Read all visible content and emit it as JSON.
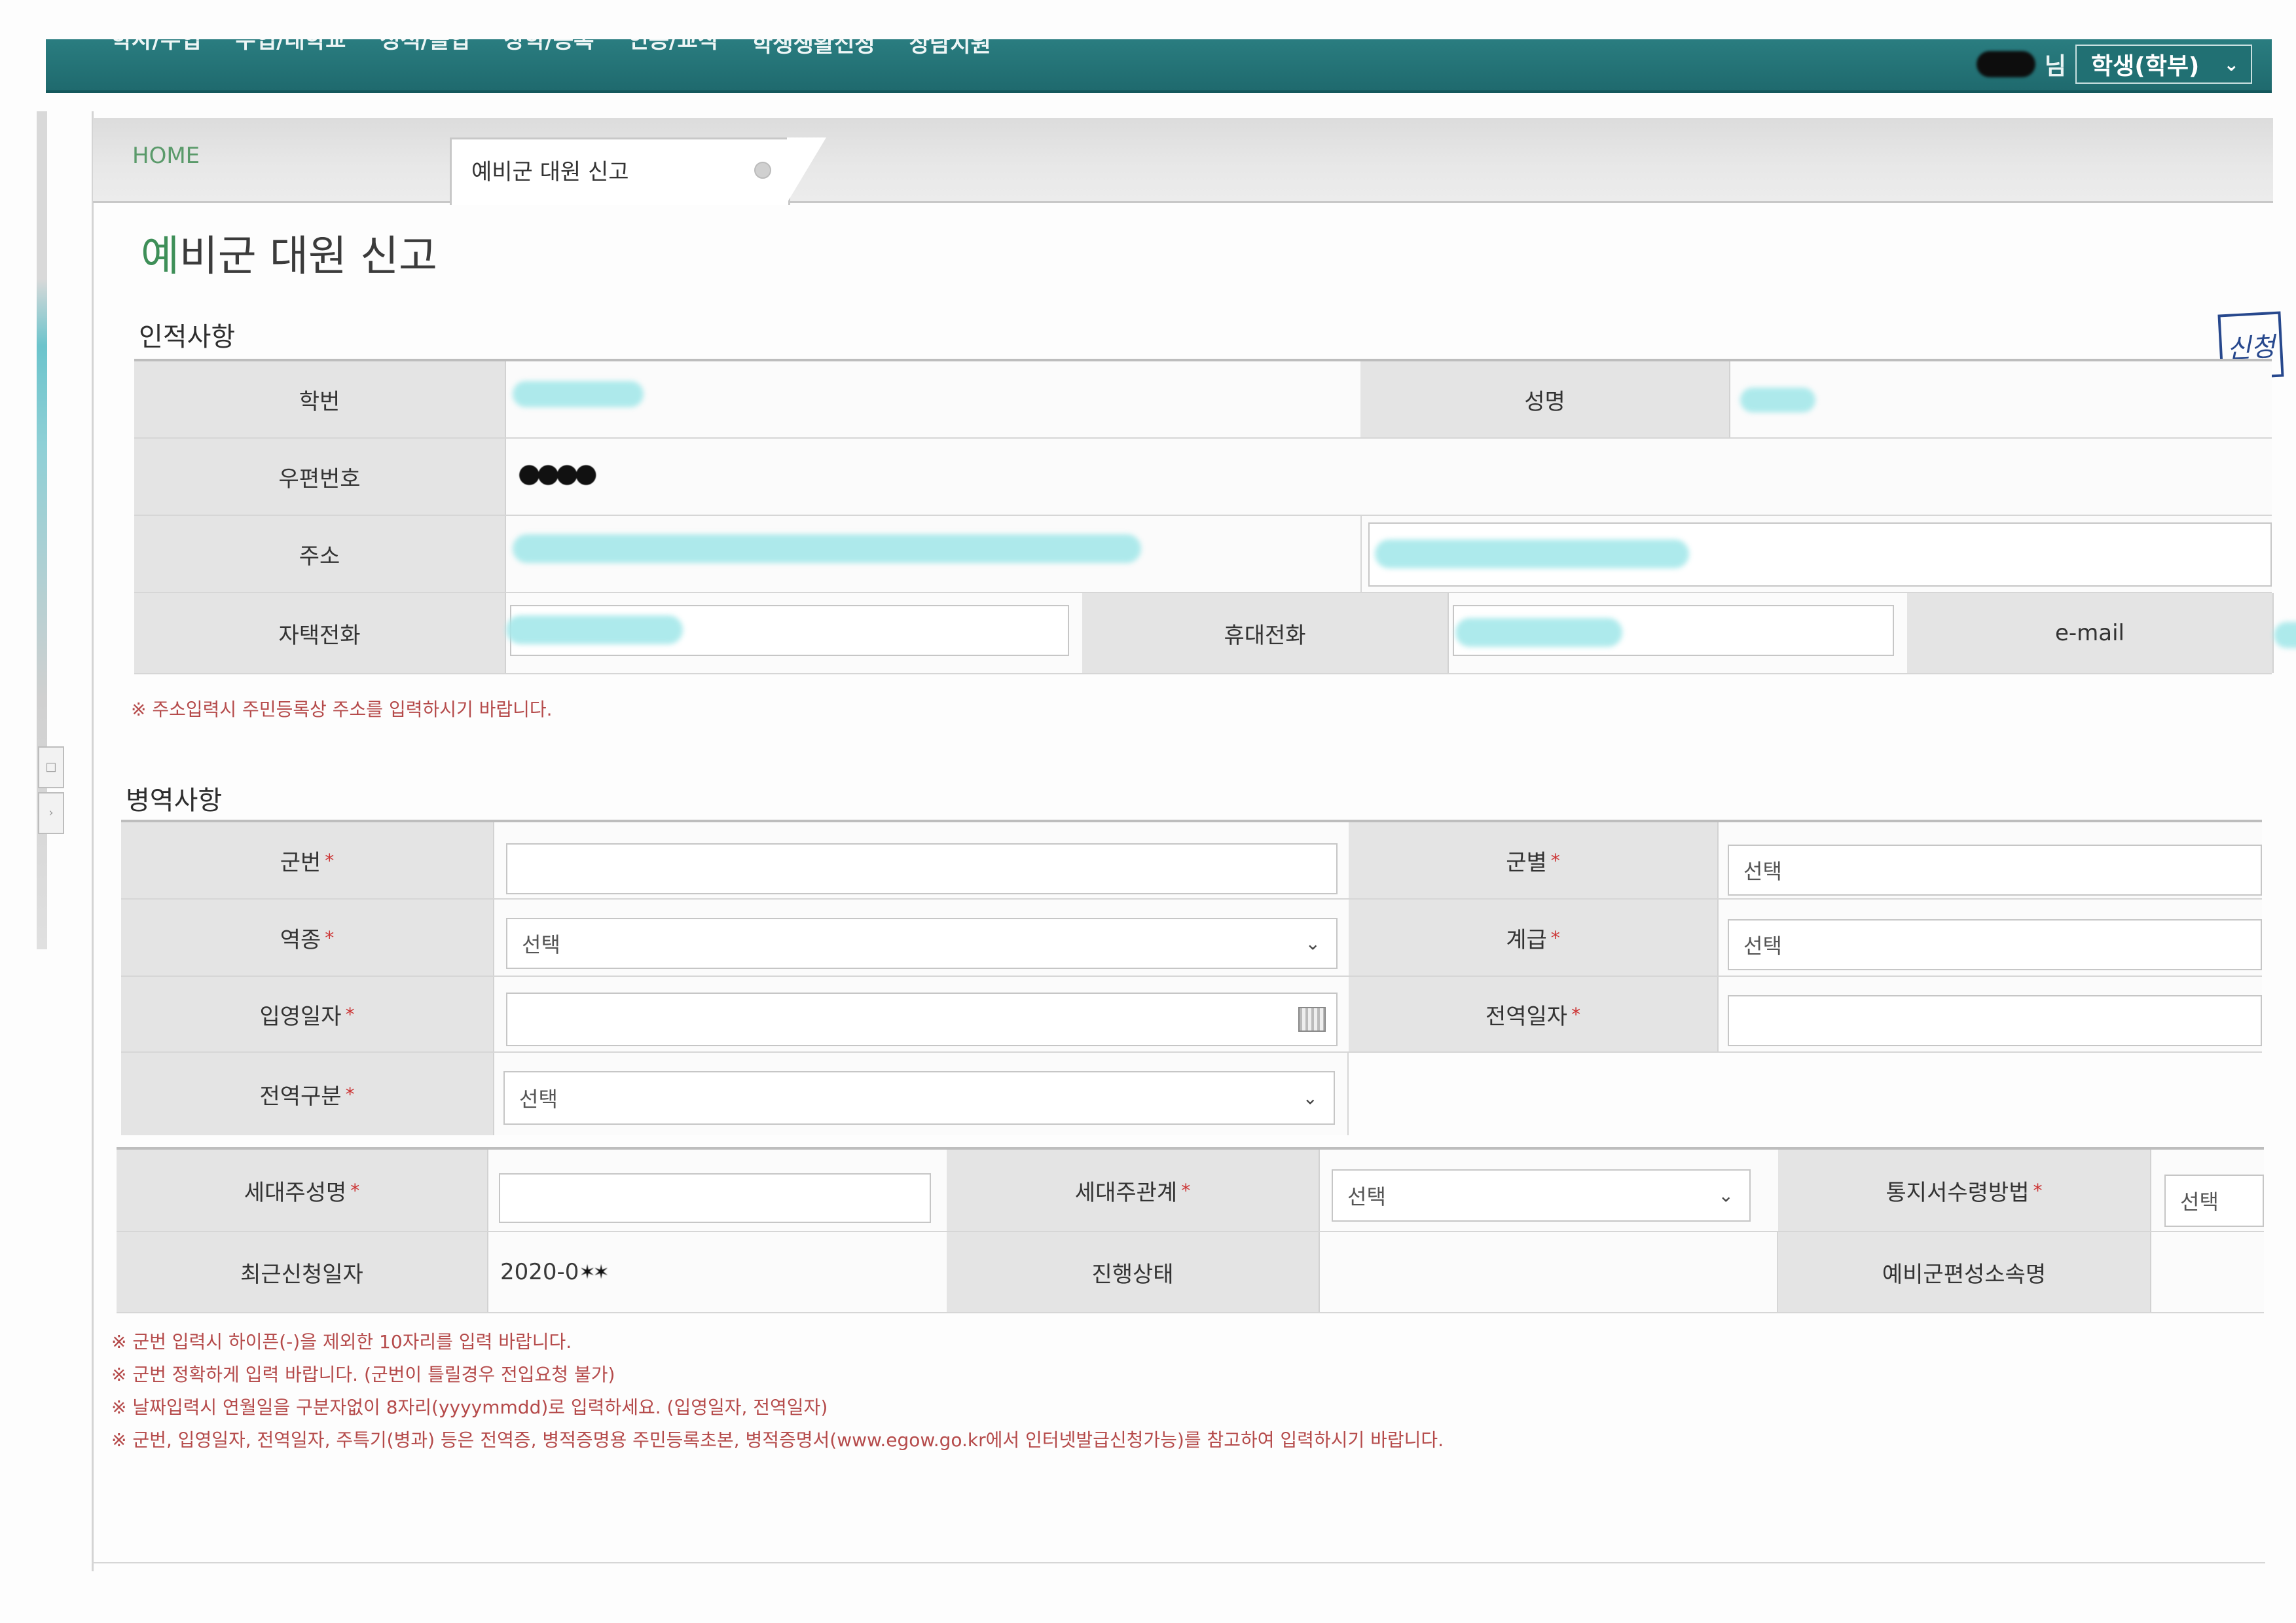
{
  "nav": {
    "items": [
      "학사/수업",
      "수업/대학교",
      "성적/졸업",
      "장학/등록",
      "인증/교직",
      "학생생활신청",
      "상담지원"
    ],
    "user_suffix": "님",
    "role": "학생(학부)"
  },
  "tabs": {
    "home": "HOME",
    "active": "예비군 대원 신고"
  },
  "page_title": {
    "first_char": "예",
    "rest": "비군 대원 신고"
  },
  "stamp": "신청",
  "personal": {
    "section_title": "인적사항",
    "labels": {
      "student_id": "학번",
      "name": "성명",
      "zip": "우편번호",
      "address": "주소",
      "home_phone": "자택전화",
      "mobile": "휴대전화",
      "email": "e-mail"
    },
    "note": "※ 주소입력시 주민등록상 주소를 입력하시기 바랍니다."
  },
  "military": {
    "section_title": "병역사항",
    "labels": {
      "service_number": "군번",
      "branch": "군별",
      "service_type": "역종",
      "rank": "계급",
      "enlist_date": "입영일자",
      "discharge_date": "전역일자",
      "discharge_type": "전역구분"
    },
    "select_placeholder": "선택"
  },
  "household": {
    "labels": {
      "head_name": "세대주성명",
      "head_relation": "세대주관계",
      "notice_method": "통지서수령방법",
      "recent_date": "최근신청일자",
      "status": "진행상태",
      "unit_name": "예비군편성소속명"
    },
    "recent_date_value": "2020-0",
    "select_placeholder": "선택"
  },
  "notes": [
    "※ 군번 입력시 하이픈(-)을 제외한 10자리를 입력 바랍니다.",
    "※ 군번 정확하게 입력 바랍니다. (군번이 틀릴경우 전입요청 불가)",
    "※ 날짜입력시 연월일을 구분자없이 8자리(yyyymmdd)로 입력하세요. (입영일자, 전역일자)",
    "※ 군번, 입영일자, 전역일자, 주특기(병과) 등은 전역증, 병적증명용 주민등록초본, 병적증명서(www.egow.go.kr에서 인터넷발급신청가능)를 참고하여 입력하시기 바랍니다."
  ],
  "colors": {
    "nav_bg": "#217073",
    "label_bg": "#e4e4e4",
    "required": "#cc3333",
    "note_text": "#b54a4a",
    "redaction": "#a5e8ea"
  },
  "icons": [
    "chevron-down-icon",
    "calendar-icon",
    "tab-close-icon"
  ]
}
